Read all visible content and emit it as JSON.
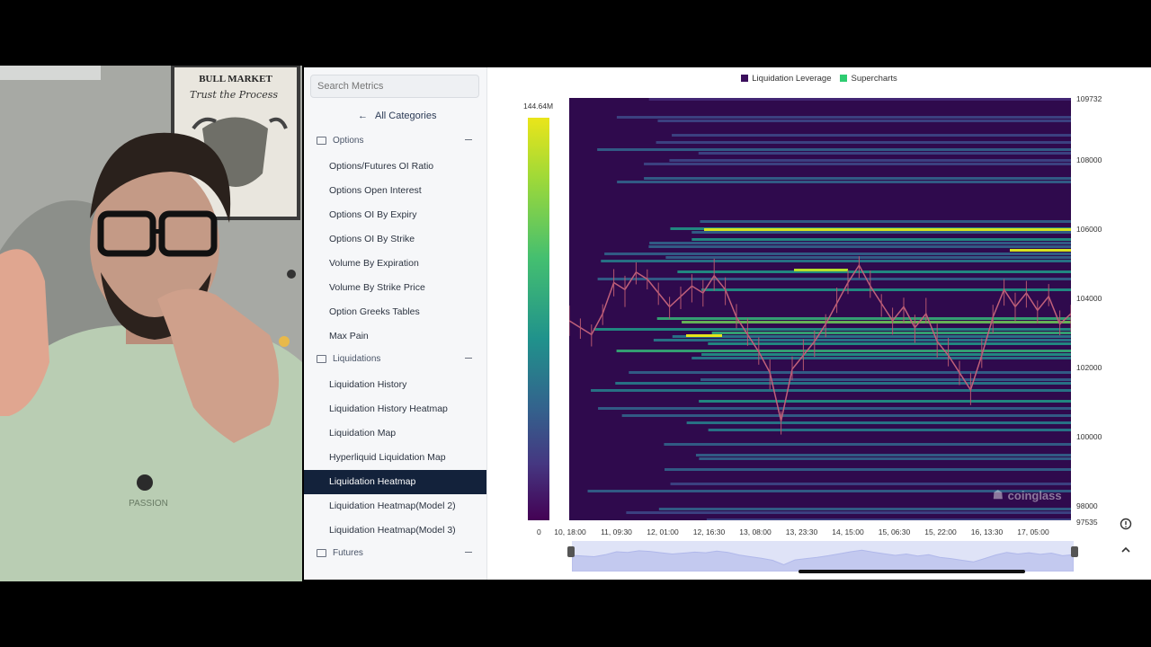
{
  "search": {
    "placeholder": "Search Metrics"
  },
  "nav": {
    "back_label": "All Categories"
  },
  "sidebar": {
    "categories": [
      {
        "label": "Options",
        "items": [
          "Options/Futures OI Ratio",
          "Options Open Interest",
          "Options OI By Expiry",
          "Options OI By Strike",
          "Volume By Expiration",
          "Volume By Strike Price",
          "Option Greeks Tables",
          "Max Pain"
        ]
      },
      {
        "label": "Liquidations",
        "items": [
          "Liquidation History",
          "Liquidation History Heatmap",
          "Liquidation Map",
          "Hyperliquid Liquidation Map",
          "Liquidation Heatmap",
          "Liquidation Heatmap(Model 2)",
          "Liquidation Heatmap(Model 3)"
        ]
      },
      {
        "label": "Futures",
        "items": []
      }
    ],
    "active_item": "Liquidation Heatmap"
  },
  "poster": {
    "title": "BULL MARKET",
    "subtitle": "Trust the Process"
  },
  "shirt_text": "PASSION",
  "watermark": "coinglass",
  "colors": {
    "active_bg": "#13223b",
    "leverage": "#3b0f5c",
    "supercharts": "#2ecc71"
  },
  "icons": [
    "back-arrow-icon",
    "folder-icon",
    "collapse-minus-icon",
    "settings-icon",
    "chevron-up-icon",
    "coinglass-logo-icon"
  ],
  "chart_data": {
    "type": "heatmap",
    "legend": [
      {
        "name": "Liquidation Leverage",
        "color": "#3b0f5c"
      },
      {
        "name": "Supercharts",
        "color": "#2ecc71"
      }
    ],
    "colorbar": {
      "max_label": "144.64M",
      "min_label": "0"
    },
    "y_ticks": [
      "109732",
      "108000",
      "106000",
      "104000",
      "102000",
      "100000",
      "98000",
      "97535"
    ],
    "ylim": [
      97535,
      109732
    ],
    "x_ticks": [
      "10, 18:00",
      "11, 09:30",
      "12, 01:00",
      "12, 16:30",
      "13, 08:00",
      "13, 23:30",
      "14, 15:00",
      "15, 06:30",
      "15, 22:00",
      "16, 13:30",
      "17, 05:00"
    ],
    "price_line": [
      103300,
      103100,
      102900,
      103500,
      104400,
      104200,
      104700,
      104500,
      104100,
      103700,
      104000,
      104300,
      104100,
      104600,
      104200,
      103400,
      102900,
      102400,
      101800,
      100400,
      101900,
      102300,
      102700,
      103200,
      103800,
      104400,
      104900,
      104300,
      103800,
      103300,
      103700,
      103100,
      103500,
      102700,
      102300,
      101800,
      101300,
      102300,
      103400,
      104200,
      103700,
      104100,
      103600,
      104000,
      103200,
      103500
    ]
  }
}
